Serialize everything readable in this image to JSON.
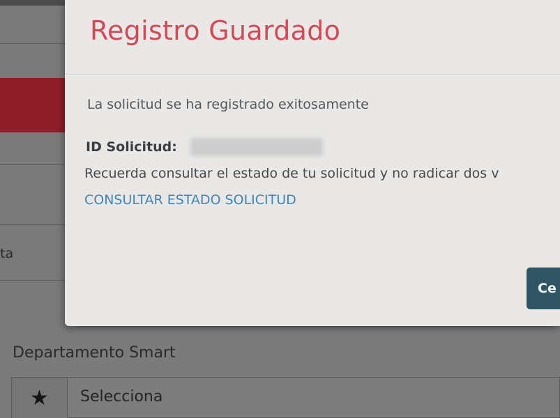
{
  "modal": {
    "title": "Registro Guardado",
    "message": "La solicitud se ha registrado exitosamente",
    "id_label": "ID Solicitud:",
    "reminder": "Recuerda consultar el estado de tu solicitud y no radicar dos v",
    "consult_link": "CONSULTAR ESTADO SOLICITUD",
    "close_button_label": "Ce"
  },
  "background_form": {
    "partial_label": "ta",
    "department_label": "Departamento Smart",
    "department_select": {
      "icon": "star-icon",
      "value": "Selecciona"
    }
  },
  "colors": {
    "title": "#d04a5a",
    "link": "#3e86b8",
    "button": "#2f5564",
    "accent_red": "#8f1e2a"
  }
}
